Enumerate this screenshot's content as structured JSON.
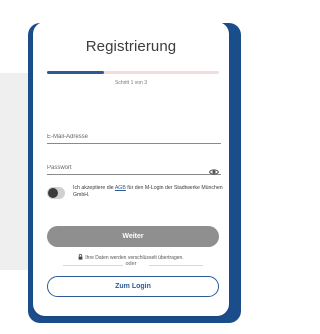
{
  "card": {
    "title": "Registrierung",
    "progress": {
      "fraction": 0.33,
      "step_text": "Schritt 1 von 3"
    }
  },
  "form": {
    "email": {
      "placeholder": "E-Mail-Adresse",
      "value": ""
    },
    "password": {
      "placeholder": "Passwort",
      "value": "",
      "icon": "eye-icon"
    },
    "consent": {
      "checked": false,
      "text_before": "Ich akzeptiere die ",
      "link": "AGB",
      "text_after": " für den M-Login der Stadtwerke München GmbH."
    }
  },
  "buttons": {
    "submit_label": "Weiter",
    "login_label": "Zum Login"
  },
  "secure_note": {
    "icon": "lock-icon",
    "text": "Ihre Daten werden verschlüsselt übertragen."
  },
  "divider_label": "oder",
  "colors": {
    "brand_blue": "#1a4d8a",
    "accent_blue": "#2c5a96",
    "disabled_button": "#8f8f8f"
  }
}
